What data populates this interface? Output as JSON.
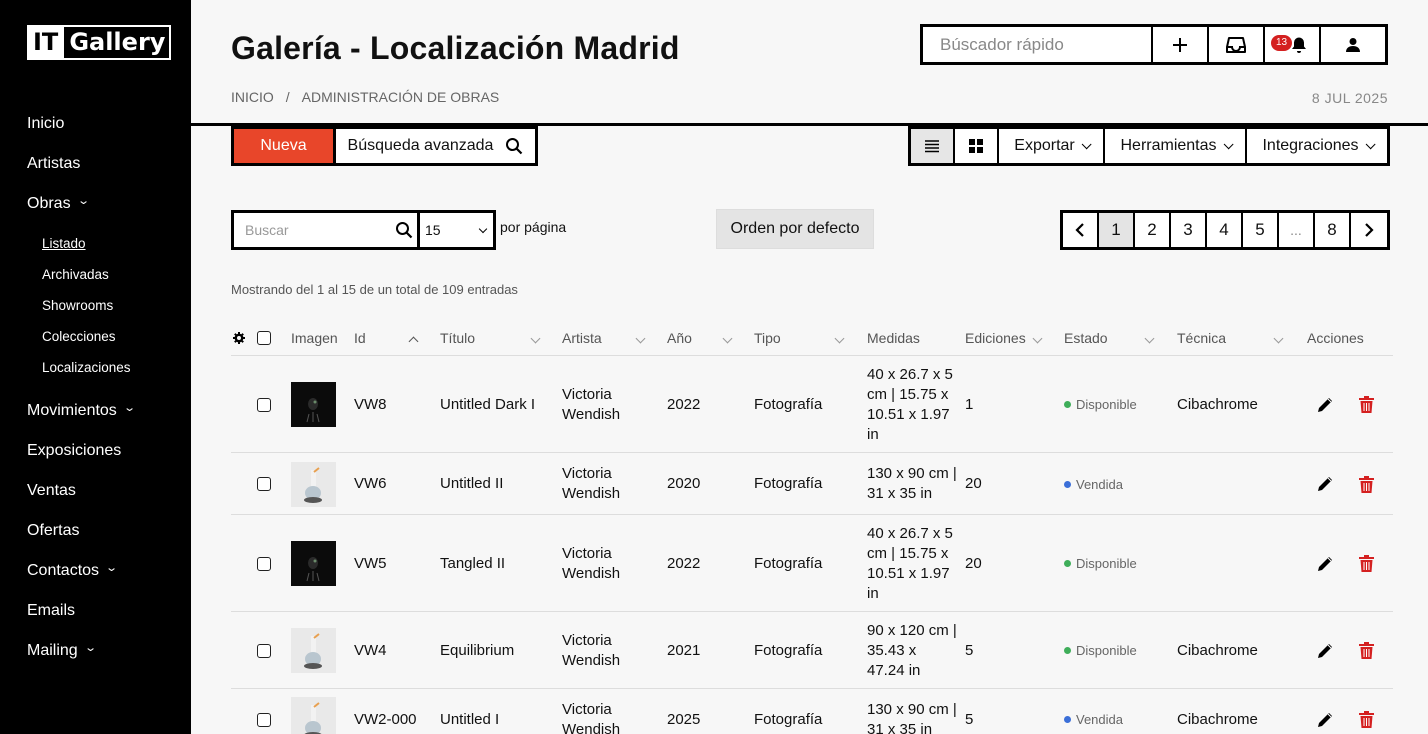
{
  "brand": {
    "it": "IT",
    "gallery": "Gallery"
  },
  "sidebar": {
    "items": [
      {
        "label": "Inicio",
        "chevron": false
      },
      {
        "label": "Artistas",
        "chevron": false
      },
      {
        "label": "Obras",
        "chevron": true
      }
    ],
    "sub_items": [
      {
        "label": "Listado",
        "active": true
      },
      {
        "label": "Archivadas"
      },
      {
        "label": "Showrooms"
      },
      {
        "label": "Colecciones"
      },
      {
        "label": "Localizaciones"
      }
    ],
    "items_after": [
      {
        "label": "Movimientos",
        "chevron": true
      },
      {
        "label": "Exposiciones",
        "chevron": false
      },
      {
        "label": "Ventas",
        "chevron": false
      },
      {
        "label": "Ofertas",
        "chevron": false
      },
      {
        "label": "Contactos",
        "chevron": true
      },
      {
        "label": "Emails",
        "chevron": false
      },
      {
        "label": "Mailing",
        "chevron": true
      }
    ]
  },
  "header": {
    "title": "Galería - Localización Madrid",
    "breadcrumb": [
      "INICIO",
      "/",
      "ADMINISTRACIÓN DE OBRAS"
    ],
    "date": "8 JUL 2025",
    "quick_search_placeholder": "Búscador rápido",
    "notifications_count": "13"
  },
  "toolbar": {
    "new_label": "Nueva",
    "advanced_search_label": "Búsqueda avanzada",
    "export_label": "Exportar",
    "tools_label": "Herramientas",
    "integrations_label": "Integraciones"
  },
  "filters": {
    "search_placeholder": "Buscar",
    "per_page_value": "15",
    "per_page_label": "por página",
    "sort_label": "Orden por defecto"
  },
  "pagination": {
    "prev": "‹",
    "pages": [
      "1",
      "2",
      "3",
      "4",
      "5",
      "...",
      "8"
    ],
    "active": "1",
    "next": "›"
  },
  "showing_text": "Mostrando del 1 al 15 de un total de 109 entradas",
  "table": {
    "headers": {
      "image": "Imagen",
      "id": "Id",
      "title": "Título",
      "artist": "Artista",
      "year": "Año",
      "type": "Tipo",
      "measures": "Medidas",
      "editions": "Ediciones",
      "status": "Estado",
      "technique": "Técnica",
      "actions": "Acciones"
    },
    "rows": [
      {
        "id": "VW8",
        "title": "Untitled Dark I",
        "artist": "Victoria Wendish",
        "year": "2022",
        "type": "Fotografía",
        "measures": "40 x 26.7 x 5 cm | 15.75 x 10.51 x 1.97 in",
        "editions": "1",
        "status": "Disponible",
        "status_color": "#3fae5a",
        "technique": "Cibachrome",
        "thumb": "dark"
      },
      {
        "id": "VW6",
        "title": "Untitled II",
        "artist": "Victoria Wendish",
        "year": "2020",
        "type": "Fotografía",
        "measures": "130 x 90 cm | 31 x 35 in",
        "editions": "20",
        "status": "Vendida",
        "status_color": "#3b6fd8",
        "technique": "",
        "thumb": "light"
      },
      {
        "id": "VW5",
        "title": "Tangled II",
        "artist": "Victoria Wendish",
        "year": "2022",
        "type": "Fotografía",
        "measures": "40 x 26.7 x 5 cm | 15.75 x 10.51 x 1.97 in",
        "editions": "20",
        "status": "Disponible",
        "status_color": "#3fae5a",
        "technique": "",
        "thumb": "dark"
      },
      {
        "id": "VW4",
        "title": "Equilibrium",
        "artist": "Victoria Wendish",
        "year": "2021",
        "type": "Fotografía",
        "measures": "90 x 120 cm | 35.43 x 47.24 in",
        "editions": "5",
        "status": "Disponible",
        "status_color": "#3fae5a",
        "technique": "Cibachrome",
        "thumb": "light"
      },
      {
        "id": "VW2-000",
        "title": "Untitled I",
        "artist": "Victoria Wendish",
        "year": "2025",
        "type": "Fotografía",
        "measures": "130 x 90 cm | 31 x 35 in",
        "editions": "5",
        "status": "Vendida",
        "status_color": "#3b6fd8",
        "technique": "Cibachrome",
        "thumb": "light"
      }
    ]
  }
}
